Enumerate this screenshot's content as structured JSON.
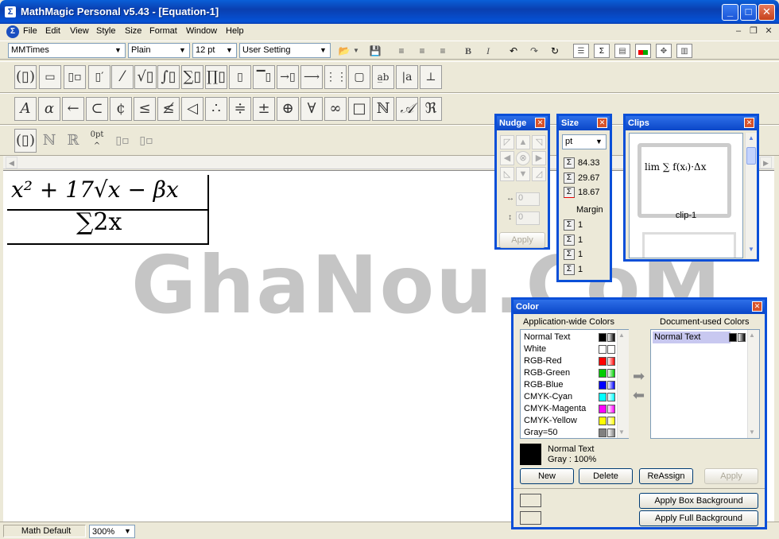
{
  "window": {
    "title": "MathMagic Personal v5.43 - [Equation-1]",
    "minimize": "_",
    "maximize": "□",
    "close": "✕"
  },
  "menu": [
    "File",
    "Edit",
    "View",
    "Style",
    "Size",
    "Format",
    "Window",
    "Help"
  ],
  "toolbar": {
    "font": "MMTimes",
    "style": "Plain",
    "size": "12 pt",
    "spacing": "User Setting"
  },
  "equation": {
    "numerator": "x² + 17√x − βx",
    "denominator": "∑2x"
  },
  "watermark": "GhaNou.CoM",
  "status": {
    "mode": "Math Default",
    "zoom": "300%"
  },
  "nudge": {
    "title": "Nudge",
    "h_value": "0",
    "v_value": "0",
    "apply": "Apply"
  },
  "size_panel": {
    "title": "Size",
    "unit": "pt",
    "values": [
      "84.33",
      "29.67",
      "18.67"
    ],
    "margin_label": "Margin",
    "margins": [
      "1",
      "1",
      "1",
      "1"
    ]
  },
  "clips": {
    "title": "Clips",
    "items": [
      "clip-1"
    ]
  },
  "color_panel": {
    "title": "Color",
    "app_header": "Application-wide Colors",
    "doc_header": "Document-used Colors",
    "app_colors": [
      {
        "name": "Normal Text",
        "color": "#000000"
      },
      {
        "name": "White",
        "color": "#ffffff"
      },
      {
        "name": "RGB-Red",
        "color": "#ff0000"
      },
      {
        "name": "RGB-Green",
        "color": "#00cc00"
      },
      {
        "name": "RGB-Blue",
        "color": "#0000ff"
      },
      {
        "name": "CMYK-Cyan",
        "color": "#00ffff"
      },
      {
        "name": "CMYK-Magenta",
        "color": "#ff00ff"
      },
      {
        "name": "CMYK-Yellow",
        "color": "#ffff00"
      },
      {
        "name": "Gray=50",
        "color": "#808080"
      }
    ],
    "doc_colors": [
      {
        "name": "Normal Text",
        "color": "#000000"
      }
    ],
    "selected_name": "Normal Text",
    "selected_gray": "Gray :  100%",
    "buttons": {
      "new": "New",
      "delete": "Delete",
      "reassign": "ReAssign",
      "apply": "Apply"
    },
    "apply_box": "Apply Box Background",
    "apply_full": "Apply Full Background"
  }
}
